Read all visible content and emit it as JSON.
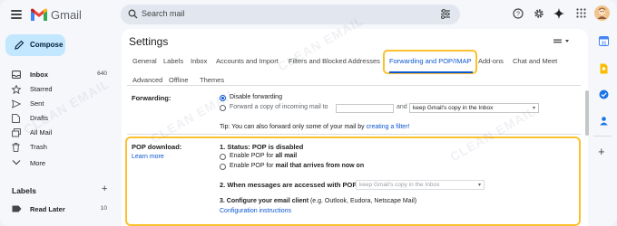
{
  "app": {
    "name": "Gmail"
  },
  "search": {
    "placeholder": "Search mail"
  },
  "sidebar": {
    "compose_label": "Compose",
    "items": [
      {
        "label": "Inbox",
        "count": "640",
        "icon": "inbox-icon",
        "active": true
      },
      {
        "label": "Starred",
        "count": "",
        "icon": "star-icon"
      },
      {
        "label": "Sent",
        "count": "",
        "icon": "sent-icon"
      },
      {
        "label": "Drafts",
        "count": "",
        "icon": "draft-icon"
      },
      {
        "label": "All Mail",
        "count": "",
        "icon": "all-mail-icon"
      },
      {
        "label": "Trash",
        "count": "",
        "icon": "trash-icon"
      },
      {
        "label": "More",
        "count": "",
        "icon": "chevron-down-icon"
      }
    ],
    "labels_heading": "Labels",
    "labels_add": "+",
    "label_items": [
      {
        "label": "Read Later",
        "count": "10"
      }
    ]
  },
  "main": {
    "title": "Settings",
    "tabs_row1": [
      "General",
      "Labels",
      "Inbox",
      "Accounts and Import",
      "Filters and Blocked Addresses",
      "Forwarding and POP/IMAP",
      "Add-ons",
      "Chat and Meet"
    ],
    "tabs_row2": [
      "Advanced",
      "Offline",
      "Themes"
    ],
    "active_tab": "Forwarding and POP/IMAP",
    "forwarding": {
      "label": "Forwarding:",
      "option_disable": "Disable forwarding",
      "option_forward": "Forward a copy of incoming mail to",
      "and": "and",
      "keep_select": "keep Gmail's copy in the Inbox",
      "tip_prefix": "Tip: You can also forward only some of your mail by",
      "tip_link": "creating a filter!"
    },
    "pop": {
      "label": "POP download:",
      "learn_more": "Learn more",
      "status": "1. Status: POP is disabled",
      "enable_all_prefix": "Enable POP for ",
      "enable_all_bold": "all mail",
      "enable_now_prefix": "Enable POP for ",
      "enable_now_bold": "mail that arrives from now on",
      "when_accessed": "2. When messages are accessed with POP",
      "when_select": "keep Gmail's copy in the Inbox",
      "configure_bold": "3. Configure your email client",
      "configure_rest": " (e.g. Outlook, Eudora, Netscape Mail)",
      "config_link": "Configuration instructions"
    }
  },
  "watermark": "CLEAN EMAIL",
  "colors": {
    "accent": "#0b57d0",
    "highlight": "#fbc02d",
    "compose_bg": "#c2e7ff",
    "gmail_red": "#ea4335"
  }
}
